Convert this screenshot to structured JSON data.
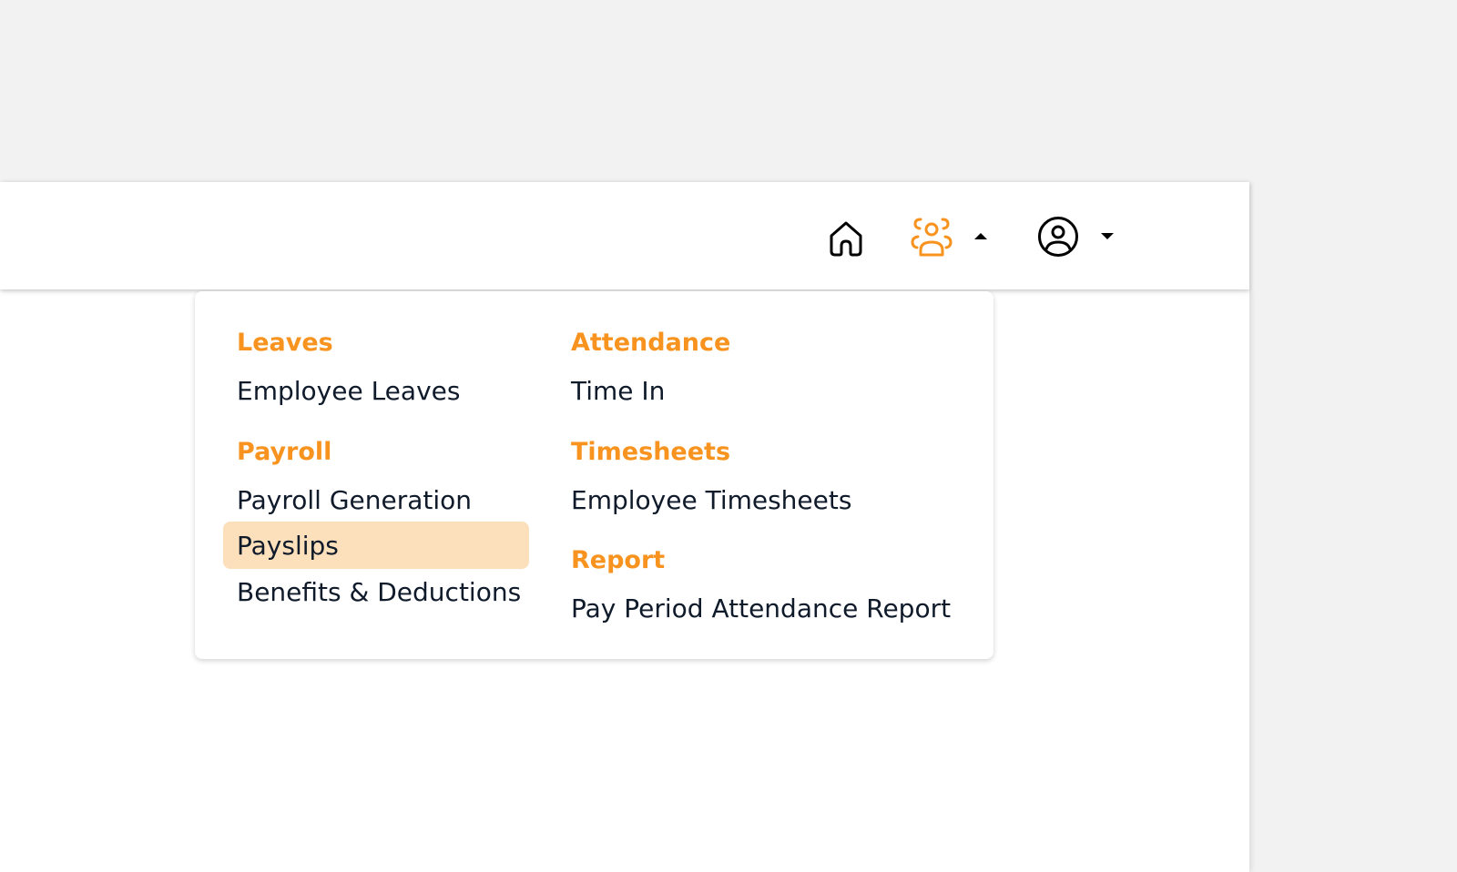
{
  "colors": {
    "accent": "#f7931e",
    "active_item_bg": "#fcdfbb",
    "text": "#0f1a2a",
    "page_bg": "#f2f2f2"
  },
  "header": {
    "icons": {
      "home": "home-icon",
      "people": "people-group-icon",
      "people_caret": "caret-up-icon",
      "user": "user-circle-icon",
      "user_caret": "caret-down-icon"
    }
  },
  "menu": {
    "left_column": [
      {
        "title": "Leaves",
        "items": [
          {
            "label": "Employee Leaves",
            "active": false
          }
        ]
      },
      {
        "title": "Payroll",
        "items": [
          {
            "label": "Payroll Generation",
            "active": false
          },
          {
            "label": "Payslips",
            "active": true
          },
          {
            "label": "Benefits & Deductions",
            "active": false
          }
        ]
      }
    ],
    "right_column": [
      {
        "title": "Attendance",
        "items": [
          {
            "label": "Time In",
            "active": false
          }
        ]
      },
      {
        "title": "Timesheets",
        "items": [
          {
            "label": "Employee Timesheets",
            "active": false
          }
        ]
      },
      {
        "title": "Report",
        "items": [
          {
            "label": "Pay Period Attendance Report",
            "active": false
          }
        ]
      }
    ]
  }
}
